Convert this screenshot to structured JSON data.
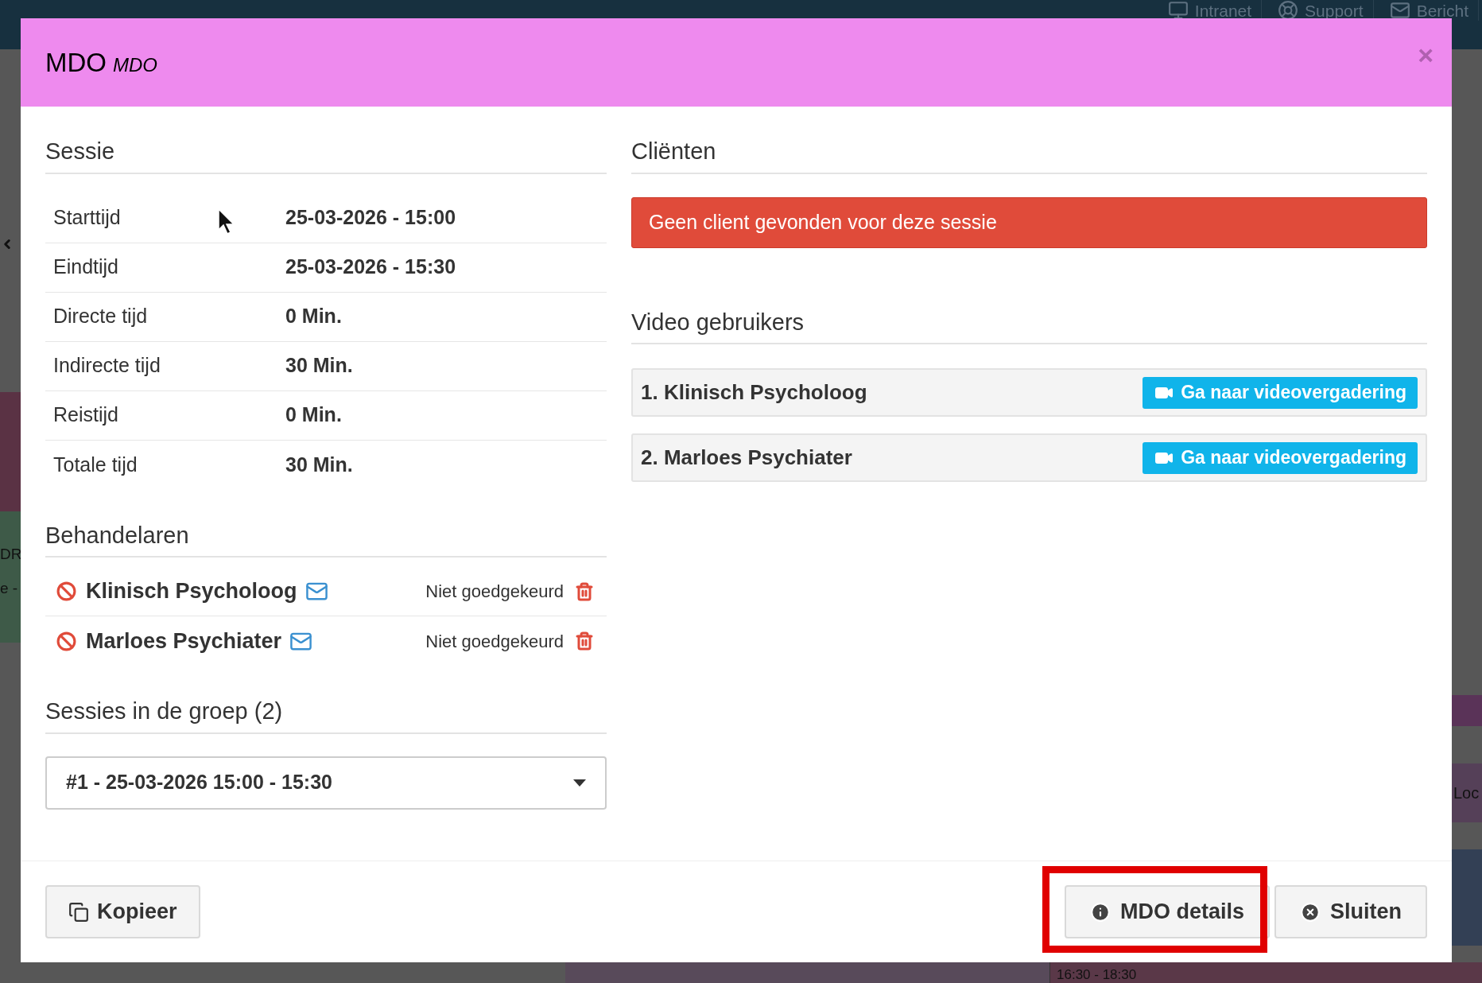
{
  "background": {
    "nav": [
      {
        "label": "Intranet",
        "kind": "monitor"
      },
      {
        "label": "Support",
        "kind": "lifebuoy"
      },
      {
        "label": "Bericht",
        "kind": "mail"
      }
    ],
    "left_fragments": [
      "DR",
      "e -"
    ],
    "right_fragment": "Loc",
    "bottom_event": "16:30 - 18:30"
  },
  "modal": {
    "title": "MDO",
    "subtitle": "MDO",
    "close": "×",
    "sessie": {
      "heading": "Sessie",
      "rows": [
        {
          "label": "Starttijd",
          "value": "25-03-2026 - 15:00"
        },
        {
          "label": "Eindtijd",
          "value": "25-03-2026 - 15:30"
        },
        {
          "label": "Directe tijd",
          "value": "0 Min."
        },
        {
          "label": "Indirecte tijd",
          "value": "30 Min."
        },
        {
          "label": "Reistijd",
          "value": "0 Min."
        },
        {
          "label": "Totale tijd",
          "value": "30 Min."
        }
      ]
    },
    "behandelaren": {
      "heading": "Behandelaren",
      "items": [
        {
          "name": "Klinisch Psycholoog",
          "status": "Niet goedgekeurd",
          "approved": false
        },
        {
          "name": "Marloes Psychiater",
          "status": "Niet goedgekeurd",
          "approved": false
        }
      ]
    },
    "groep": {
      "heading": "Sessies in de groep (2)",
      "select_value": "#1 - 25-03-2026 15:00 - 15:30"
    },
    "clienten": {
      "heading": "Cliënten",
      "alert": "Geen client gevonden voor deze sessie"
    },
    "video": {
      "heading": "Video gebruikers",
      "users": [
        {
          "name": "1. Klinisch Psycholoog",
          "button": "Ga naar videovergadering"
        },
        {
          "name": "2. Marloes Psychiater",
          "button": "Ga naar videovergadering"
        }
      ]
    },
    "footer": {
      "copy_button": "Kopieer",
      "buttons": [
        {
          "label": "MDO details",
          "kind": "info",
          "highlighted": true
        },
        {
          "label": "Sluiten",
          "kind": "close",
          "highlighted": false
        }
      ]
    }
  }
}
